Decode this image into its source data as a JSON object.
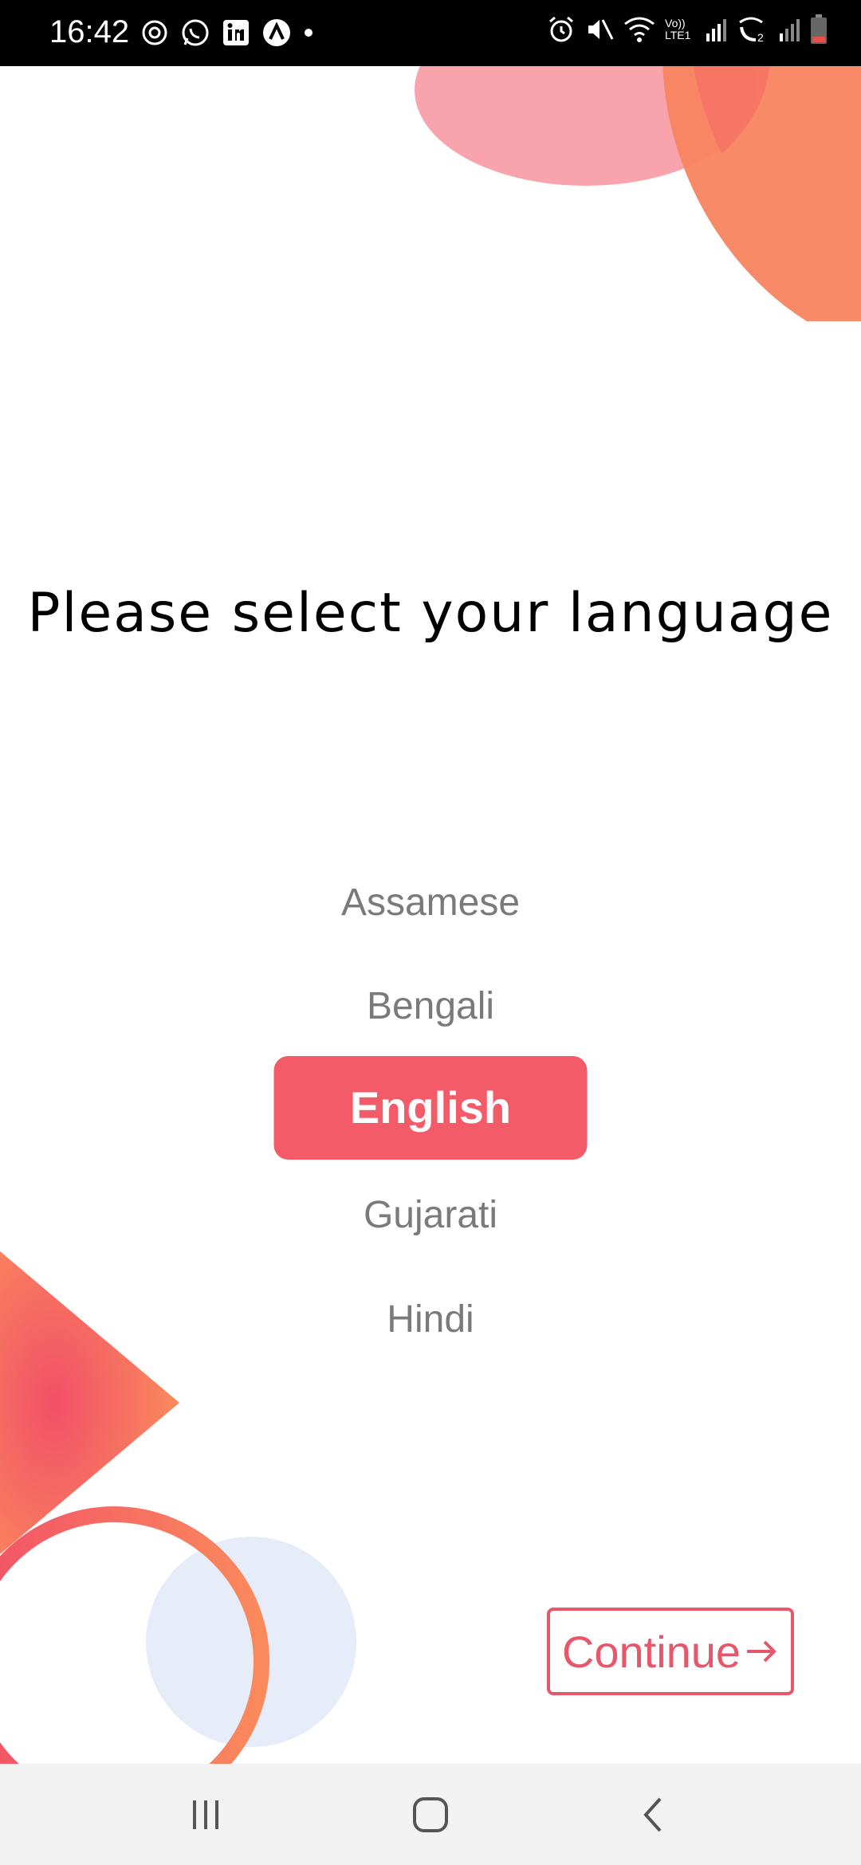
{
  "status_bar": {
    "time": "16:42",
    "left_icons": [
      "sync-icon",
      "whatsapp-icon",
      "linkedin-icon",
      "app-a-icon",
      "dot-icon"
    ],
    "right_icons": [
      "alarm-icon",
      "mute-icon",
      "wifi-icon",
      "volte-lte1-icon",
      "signal-icon",
      "wifi-call-2-icon",
      "signal-2-icon",
      "battery-icon"
    ],
    "volte_text": "Vo)) LTE1"
  },
  "main": {
    "title": "Please select your language",
    "languages": [
      "Assamese",
      "Bengali",
      "English",
      "Gujarati",
      "Hindi"
    ],
    "selected_language": "English",
    "continue_label": "Continue"
  },
  "nav_bar": {
    "buttons": [
      "recents-icon",
      "home-icon",
      "back-icon"
    ]
  },
  "colors": {
    "accent": "#f45b69",
    "continue": "#e8566a",
    "option_text": "#7a7a7a",
    "deco_pink": "#f9a3ad",
    "deco_orange": "#f8845f",
    "deco_blue": "#e6ecf8"
  }
}
